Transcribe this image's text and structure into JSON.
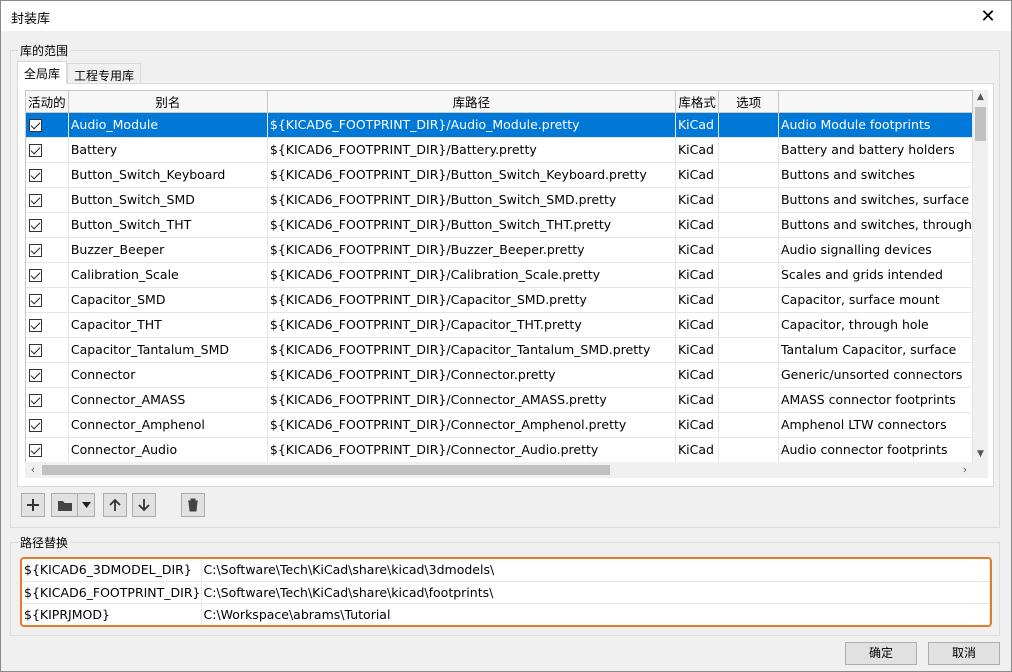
{
  "window": {
    "title": "封装库",
    "close_glyph": "✕"
  },
  "scope_group": {
    "label": "库的范围"
  },
  "tabs": [
    {
      "label": "全局库",
      "active": true
    },
    {
      "label": "工程专用库",
      "active": false
    }
  ],
  "table": {
    "columns": [
      "活动的",
      "别名",
      "库路径",
      "库格式",
      "选项",
      ""
    ],
    "rows": [
      {
        "active": true,
        "alias": "Audio_Module",
        "path": "${KICAD6_FOOTPRINT_DIR}/Audio_Module.pretty",
        "format": "KiCad",
        "options": "",
        "desc": "Audio Module footprints",
        "selected": true
      },
      {
        "active": true,
        "alias": "Battery",
        "path": "${KICAD6_FOOTPRINT_DIR}/Battery.pretty",
        "format": "KiCad",
        "options": "",
        "desc": "Battery and battery holders"
      },
      {
        "active": true,
        "alias": "Button_Switch_Keyboard",
        "path": "${KICAD6_FOOTPRINT_DIR}/Button_Switch_Keyboard.pretty",
        "format": "KiCad",
        "options": "",
        "desc": "Buttons and switches"
      },
      {
        "active": true,
        "alias": "Button_Switch_SMD",
        "path": "${KICAD6_FOOTPRINT_DIR}/Button_Switch_SMD.pretty",
        "format": "KiCad",
        "options": "",
        "desc": "Buttons and switches, surface"
      },
      {
        "active": true,
        "alias": "Button_Switch_THT",
        "path": "${KICAD6_FOOTPRINT_DIR}/Button_Switch_THT.pretty",
        "format": "KiCad",
        "options": "",
        "desc": "Buttons and switches, through"
      },
      {
        "active": true,
        "alias": "Buzzer_Beeper",
        "path": "${KICAD6_FOOTPRINT_DIR}/Buzzer_Beeper.pretty",
        "format": "KiCad",
        "options": "",
        "desc": "Audio signalling devices"
      },
      {
        "active": true,
        "alias": "Calibration_Scale",
        "path": "${KICAD6_FOOTPRINT_DIR}/Calibration_Scale.pretty",
        "format": "KiCad",
        "options": "",
        "desc": "Scales and grids intended"
      },
      {
        "active": true,
        "alias": "Capacitor_SMD",
        "path": "${KICAD6_FOOTPRINT_DIR}/Capacitor_SMD.pretty",
        "format": "KiCad",
        "options": "",
        "desc": "Capacitor, surface mount"
      },
      {
        "active": true,
        "alias": "Capacitor_THT",
        "path": "${KICAD6_FOOTPRINT_DIR}/Capacitor_THT.pretty",
        "format": "KiCad",
        "options": "",
        "desc": "Capacitor, through hole"
      },
      {
        "active": true,
        "alias": "Capacitor_Tantalum_SMD",
        "path": "${KICAD6_FOOTPRINT_DIR}/Capacitor_Tantalum_SMD.pretty",
        "format": "KiCad",
        "options": "",
        "desc": "Tantalum Capacitor, surface"
      },
      {
        "active": true,
        "alias": "Connector",
        "path": "${KICAD6_FOOTPRINT_DIR}/Connector.pretty",
        "format": "KiCad",
        "options": "",
        "desc": "Generic/unsorted connectors"
      },
      {
        "active": true,
        "alias": "Connector_AMASS",
        "path": "${KICAD6_FOOTPRINT_DIR}/Connector_AMASS.pretty",
        "format": "KiCad",
        "options": "",
        "desc": "AMASS connector footprints"
      },
      {
        "active": true,
        "alias": "Connector_Amphenol",
        "path": "${KICAD6_FOOTPRINT_DIR}/Connector_Amphenol.pretty",
        "format": "KiCad",
        "options": "",
        "desc": "Amphenol LTW connectors"
      },
      {
        "active": true,
        "alias": "Connector_Audio",
        "path": "${KICAD6_FOOTPRINT_DIR}/Connector_Audio.pretty",
        "format": "KiCad",
        "options": "",
        "desc": "Audio connector footprints"
      }
    ]
  },
  "toolbar": [
    {
      "name": "add-library-button",
      "icon": "plus-icon"
    },
    {
      "name": "browse-library-button",
      "icon": "folder-icon"
    },
    {
      "name": "browse-dropdown-button",
      "icon": "dropdown-arrow-icon"
    },
    {
      "name": "move-up-button",
      "icon": "arrow-up-icon"
    },
    {
      "name": "move-down-button",
      "icon": "arrow-down-icon"
    },
    {
      "name": "remove-library-button",
      "icon": "trash-icon"
    }
  ],
  "path_subst": {
    "label": "路径替换",
    "rows": [
      {
        "var": "${KICAD6_3DMODEL_DIR}",
        "value": "C:\\Software\\Tech\\KiCad\\share\\kicad\\3dmodels\\"
      },
      {
        "var": "${KICAD6_FOOTPRINT_DIR}",
        "value": "C:\\Software\\Tech\\KiCad\\share\\kicad\\footprints\\"
      },
      {
        "var": "${KIPRJMOD}",
        "value": "C:\\Workspace\\abrams\\Tutorial"
      }
    ],
    "highlight_color": "#e87b2a"
  },
  "buttons": {
    "ok": "确定",
    "cancel": "取消"
  },
  "colors": {
    "selection": "#0078d7"
  }
}
